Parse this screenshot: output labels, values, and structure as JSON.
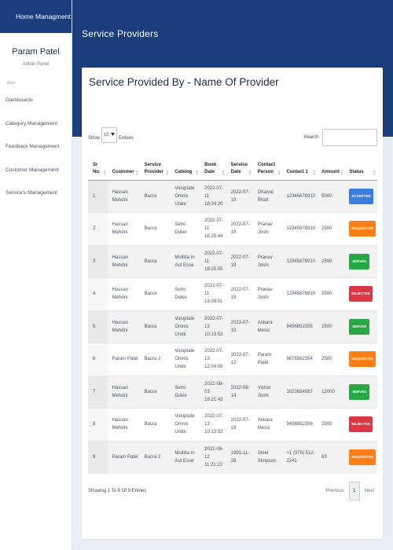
{
  "sidebar": {
    "brand": "Home Managment",
    "user_name": "Param Patel",
    "user_role": "Admin Panel",
    "section_label": "Main",
    "items": [
      {
        "label": "Dashboards"
      },
      {
        "label": "Category Management"
      },
      {
        "label": "Feedback Management"
      },
      {
        "label": "Customer Management"
      },
      {
        "label": "Service's Management"
      }
    ]
  },
  "header": {
    "title": "Service Providers"
  },
  "card": {
    "title": "Service Provided By - Name Of Provider"
  },
  "controls": {
    "show_label": "Show",
    "entries_value": "10",
    "entries_label": "Entries",
    "search_label": "Search:",
    "search_value": ""
  },
  "table": {
    "columns": [
      "Sr No.",
      "Customer",
      "Service Provider",
      "Catelog",
      "Book Date",
      "Service Date",
      "Contact Person",
      "Contact 1",
      "Amount",
      "Status"
    ],
    "rows": [
      {
        "sr": "1",
        "customer": "Hassan Mehdni",
        "provider": "Bacra",
        "catelog": "Voluptate Omnis Unde",
        "book_date": "2022-07-11 18:24:20",
        "service_date": "2022-07-19",
        "contact_person": "Dhaivat Bhatt",
        "contact": "12345678910",
        "amount": "5000",
        "status": "ACCEPTED"
      },
      {
        "sr": "2",
        "customer": "Hassan Mehdni",
        "provider": "Bacra",
        "catelog": "Semi Dulex",
        "book_date": "2022-07-11 18:25:44",
        "service_date": "2022-07-19",
        "contact_person": "Pranav Joshi",
        "contact": "12345678910",
        "amount": "2500",
        "status": "REQUESTED"
      },
      {
        "sr": "3",
        "customer": "Hassan Mehdni",
        "provider": "Bacra",
        "catelog": "Mollitia In Aut Esse",
        "book_date": "2022-07-11 18:25:55",
        "service_date": "2022-07-19",
        "contact_person": "Pranav Joshi",
        "contact": "12345678910",
        "amount": "2500",
        "status": "SERVED"
      },
      {
        "sr": "4",
        "customer": "Hassan Mehdni",
        "provider": "Bacra",
        "catelog": "Semi Dulex",
        "book_date": "2022-07-11 18:26:01",
        "service_date": "2022-07-19",
        "contact_person": "Pranav Joshi",
        "contact": "12345678910",
        "amount": "2500",
        "status": "REJECTED"
      },
      {
        "sr": "5",
        "customer": "Hassan Mehdni",
        "provider": "Bacra",
        "catelog": "Voluptate Omnis Unde",
        "book_date": "2022-07-13 10:13:53",
        "service_date": "2022-07-19",
        "contact_person": "Ankara Messi",
        "contact": "9456852356",
        "amount": "2500",
        "status": "SERVED"
      },
      {
        "sr": "6",
        "customer": "Param Patel",
        "provider": "Bacra 2",
        "catelog": "Voluptate Omnis Unde",
        "book_date": "2022-07-13 12:04:06",
        "service_date": "2022-07-12",
        "contact_person": "Param Patel",
        "contact": "9676562354",
        "amount": "2500",
        "status": "REQUESTED"
      },
      {
        "sr": "7",
        "customer": "Hassan Mehdni",
        "provider": "Bacra",
        "catelog": "Semi Dulex",
        "book_date": "2022-08-03 18:31:43",
        "service_date": "2022-09-14",
        "contact_person": "Vishal Joshi",
        "contact": "1023654587",
        "amount": "12000",
        "status": "SERVED"
      },
      {
        "sr": "8",
        "customer": "Hassan Mehdni",
        "provider": "Bacra",
        "catelog": "Voluptate Omnis Unde",
        "book_date": "2022-07-13 10:13:53",
        "service_date": "2022-07-19",
        "contact_person": "Ankara Messi",
        "contact": "9456852356",
        "amount": "2500",
        "status": "REJECTED"
      },
      {
        "sr": "9",
        "customer": "Param Patel",
        "provider": "Bacra 2",
        "catelog": "Mollitia In Aut Esse",
        "book_date": "2022-08-12 11:21:22",
        "service_date": "1991-11-28",
        "contact_person": "Steel Simpson",
        "contact": "+1 (979) 512-2241",
        "amount": "63",
        "status": "REQUESTED"
      }
    ]
  },
  "status_colors": {
    "ACCEPTED": "#3b7ddd",
    "REQUESTED": "#fd7e14",
    "SERVED": "#28a745",
    "REJECTED": "#dc3545"
  },
  "footer": {
    "info": "Showing 1 To 9 Of 9 Entries",
    "previous": "Previous",
    "page": "1",
    "next": "Next"
  }
}
